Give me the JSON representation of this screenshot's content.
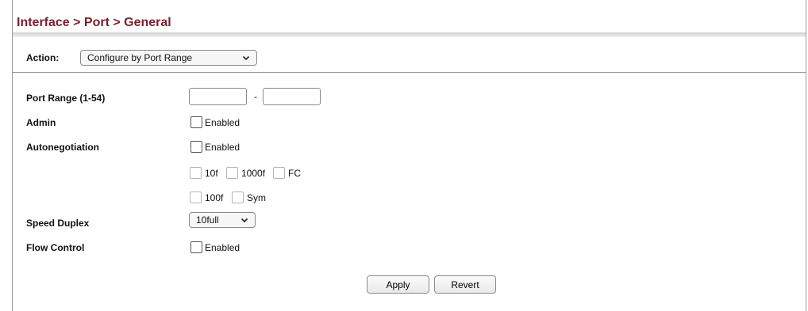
{
  "breadcrumb": "Interface > Port > General",
  "action": {
    "label": "Action:",
    "selected": "Configure by Port Range"
  },
  "port_range": {
    "label": "Port Range (1-54)",
    "from_value": "",
    "separator": "-",
    "to_value": ""
  },
  "admin": {
    "label": "Admin",
    "option": "Enabled",
    "checked": false
  },
  "autonegotiation": {
    "label": "Autonegotiation",
    "option": "Enabled",
    "checked": false,
    "capabilities_row1": [
      "10f",
      "1000f",
      "FC"
    ],
    "capabilities_row2": [
      "100f",
      "Sym"
    ]
  },
  "speed_duplex": {
    "label": "Speed Duplex",
    "selected": "10full"
  },
  "flow_control": {
    "label": "Flow Control",
    "option": "Enabled",
    "checked": false
  },
  "buttons": {
    "apply": "Apply",
    "revert": "Revert"
  },
  "colors": {
    "title": "#7a1f2b",
    "border": "#9a9a9a"
  }
}
